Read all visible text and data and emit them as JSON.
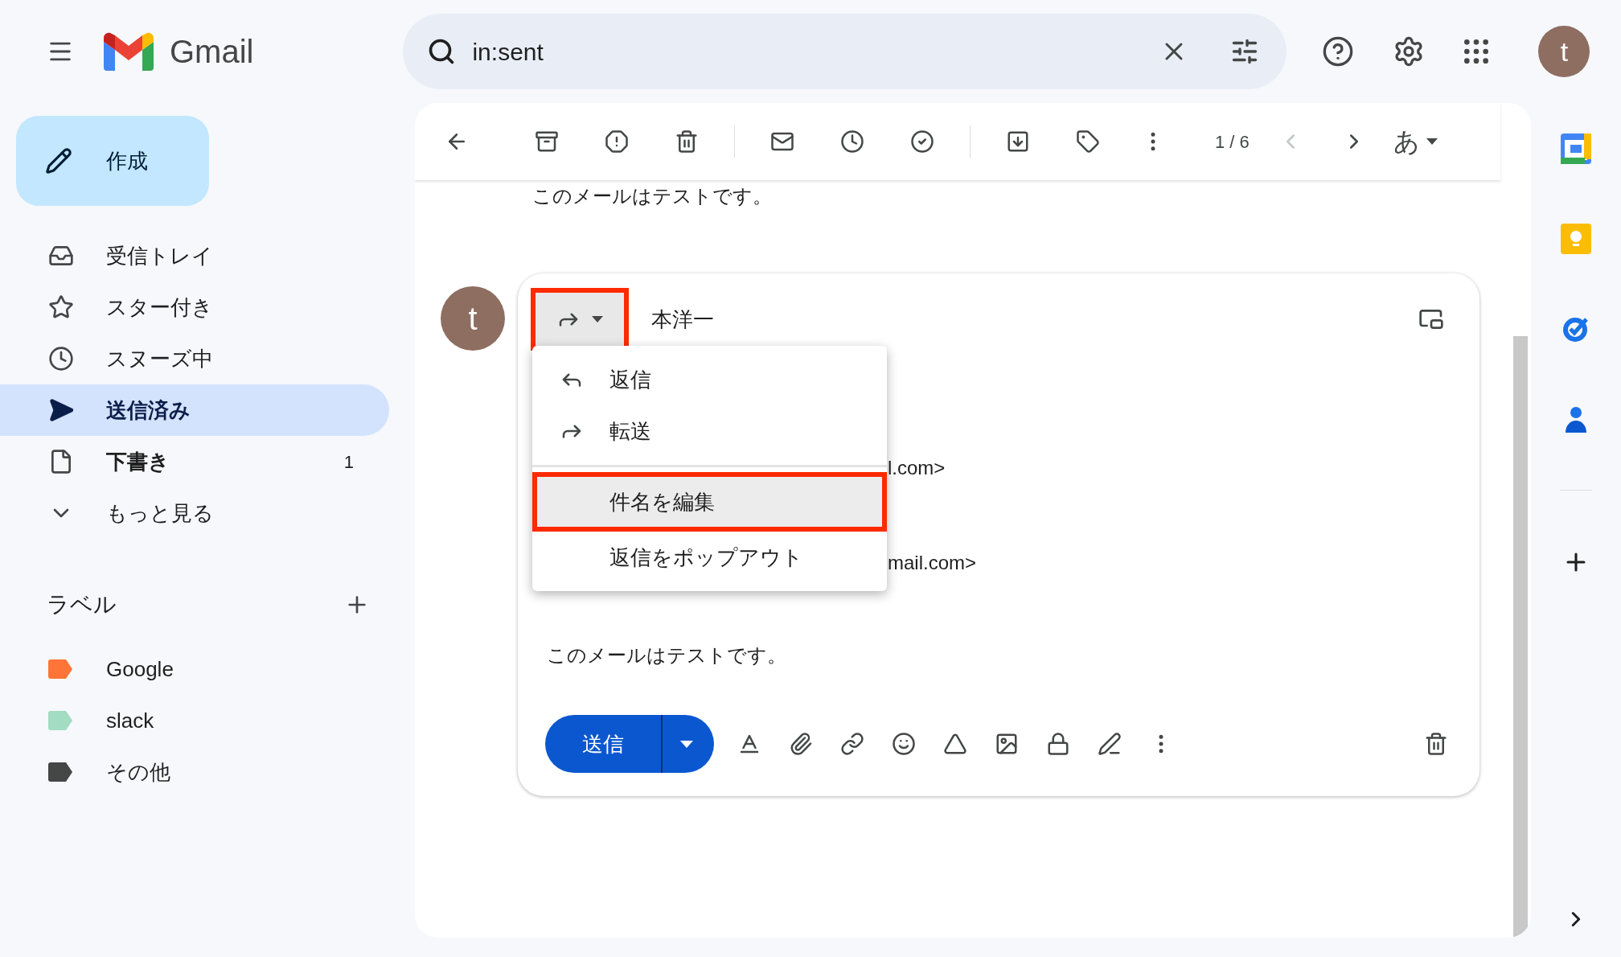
{
  "app": {
    "name": "Gmail"
  },
  "search": {
    "value": "in:sent"
  },
  "account": {
    "initial": "t"
  },
  "compose": {
    "label": "作成"
  },
  "nav": [
    {
      "label": "受信トレイ",
      "selected": false,
      "unread": false
    },
    {
      "label": "スター付き",
      "selected": false,
      "unread": false
    },
    {
      "label": "スヌーズ中",
      "selected": false,
      "unread": false
    },
    {
      "label": "送信済み",
      "selected": true,
      "unread": false
    },
    {
      "label": "下書き",
      "selected": false,
      "unread": true,
      "count": "1"
    },
    {
      "label": "もっと見る",
      "selected": false,
      "unread": false
    }
  ],
  "labels": {
    "title": "ラベル",
    "items": [
      {
        "name": "Google",
        "color": "#ff7537"
      },
      {
        "name": "slack",
        "color": "#a2dcc1"
      },
      {
        "name": "その他",
        "color": "#444746"
      }
    ]
  },
  "toolbar": {
    "counter": "1 / 6",
    "prev_disabled": true,
    "next_disabled": false,
    "input_tool": "あ"
  },
  "message": {
    "body": "このメールはテストです。"
  },
  "reply": {
    "sender_initial": "t",
    "type_button": {
      "highlighted": true
    },
    "recipient": "本洋一",
    "partial_lines": [
      "l.com>",
      "mail.com>"
    ],
    "body": "このメールはテストです。",
    "send_label": "送信"
  },
  "reply_menu": {
    "sections": [
      [
        {
          "label": "返信",
          "selected": false
        },
        {
          "label": "転送",
          "selected": false
        }
      ],
      [
        {
          "label": "件名を編集",
          "selected": true
        },
        {
          "label": "返信をポップアウト",
          "selected": false
        }
      ]
    ]
  }
}
